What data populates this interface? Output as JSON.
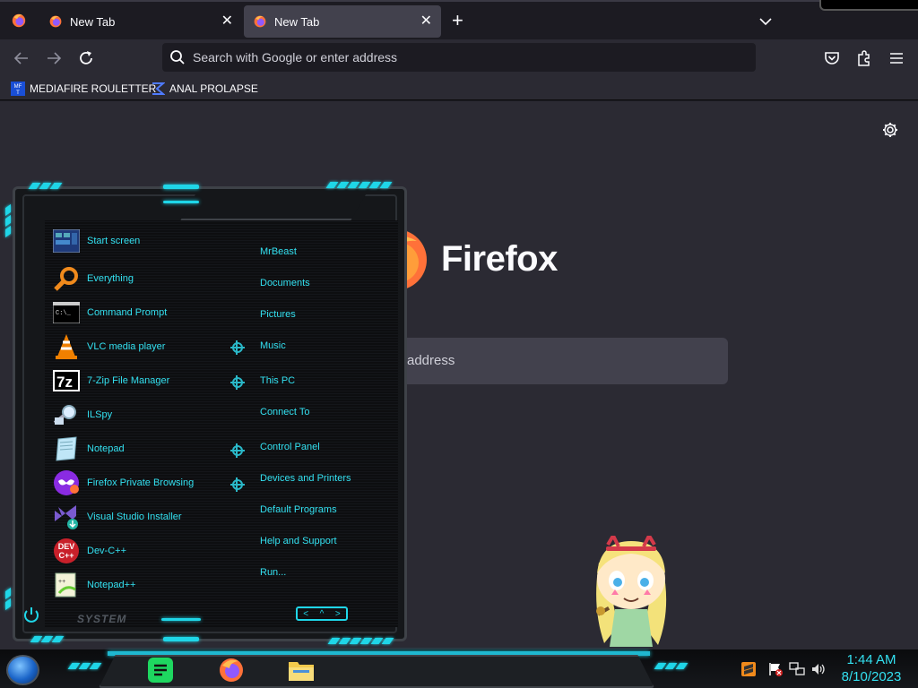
{
  "browser": {
    "tabs": [
      {
        "title": "New Tab",
        "close": "✕"
      },
      {
        "title": "New Tab",
        "close": "✕"
      }
    ],
    "new_tab": "+",
    "tablist_icon": "chevron-down-icon",
    "url_placeholder": "Search with Google or enter address",
    "bookmarks": [
      {
        "label": "MEDIAFIRE ROULETTER",
        "icon": "mediafire-icon"
      },
      {
        "label": "ANAL PROLAPSE",
        "icon": "sigma-icon"
      }
    ],
    "toolbar_icons": [
      "back-icon",
      "forward-icon",
      "reload-icon",
      "pocket-icon",
      "extensions-icon",
      "menu-icon"
    ]
  },
  "newtab_page": {
    "brand": "Firefox",
    "search_placeholder_fragment": "address",
    "settings_icon": "gear-icon"
  },
  "start_menu": {
    "programs": [
      {
        "label": "Start screen",
        "icon": "start-screen-icon"
      },
      {
        "label": "Everything",
        "icon": "magnifier-icon"
      },
      {
        "label": "Command Prompt",
        "icon": "cmd-icon"
      },
      {
        "label": "VLC media player",
        "icon": "vlc-cone-icon"
      },
      {
        "label": "7-Zip File Manager",
        "icon": "7zip-icon"
      },
      {
        "label": "ILSpy",
        "icon": "ilspy-icon"
      },
      {
        "label": "Notepad",
        "icon": "notepad-icon"
      },
      {
        "label": "Firefox Private Browsing",
        "icon": "private-browsing-icon"
      },
      {
        "label": "Visual Studio Installer",
        "icon": "vs-installer-icon"
      },
      {
        "label": "Dev-C++",
        "icon": "devcpp-icon"
      },
      {
        "label": "Notepad++",
        "icon": "notepadpp-icon"
      }
    ],
    "links": [
      {
        "label": "MrBeast",
        "has_submenu": false
      },
      {
        "label": "Documents",
        "has_submenu": false
      },
      {
        "label": "Pictures",
        "has_submenu": false
      },
      {
        "label": "Music",
        "has_submenu": true
      },
      {
        "label": "This PC",
        "has_submenu": true
      },
      {
        "label": "Connect To",
        "has_submenu": false
      },
      {
        "label": "Control Panel",
        "has_submenu": true
      },
      {
        "label": "Devices and Printers",
        "has_submenu": true
      },
      {
        "label": "Default Programs",
        "has_submenu": false
      },
      {
        "label": "Help and Support",
        "has_submenu": false
      },
      {
        "label": "Run...",
        "has_submenu": false
      }
    ],
    "system_label": "SYSTEM",
    "arrows": [
      "<",
      "^",
      ">"
    ],
    "accent": "#1fd6e8"
  },
  "taskbar": {
    "apps": [
      "notes-app-icon",
      "firefox-icon",
      "file-explorer-icon"
    ],
    "tray": [
      "sublime-icon",
      "action-center-flag-icon",
      "network-icon",
      "volume-icon"
    ],
    "time": "1:44 AM",
    "date": "8/10/2023"
  }
}
